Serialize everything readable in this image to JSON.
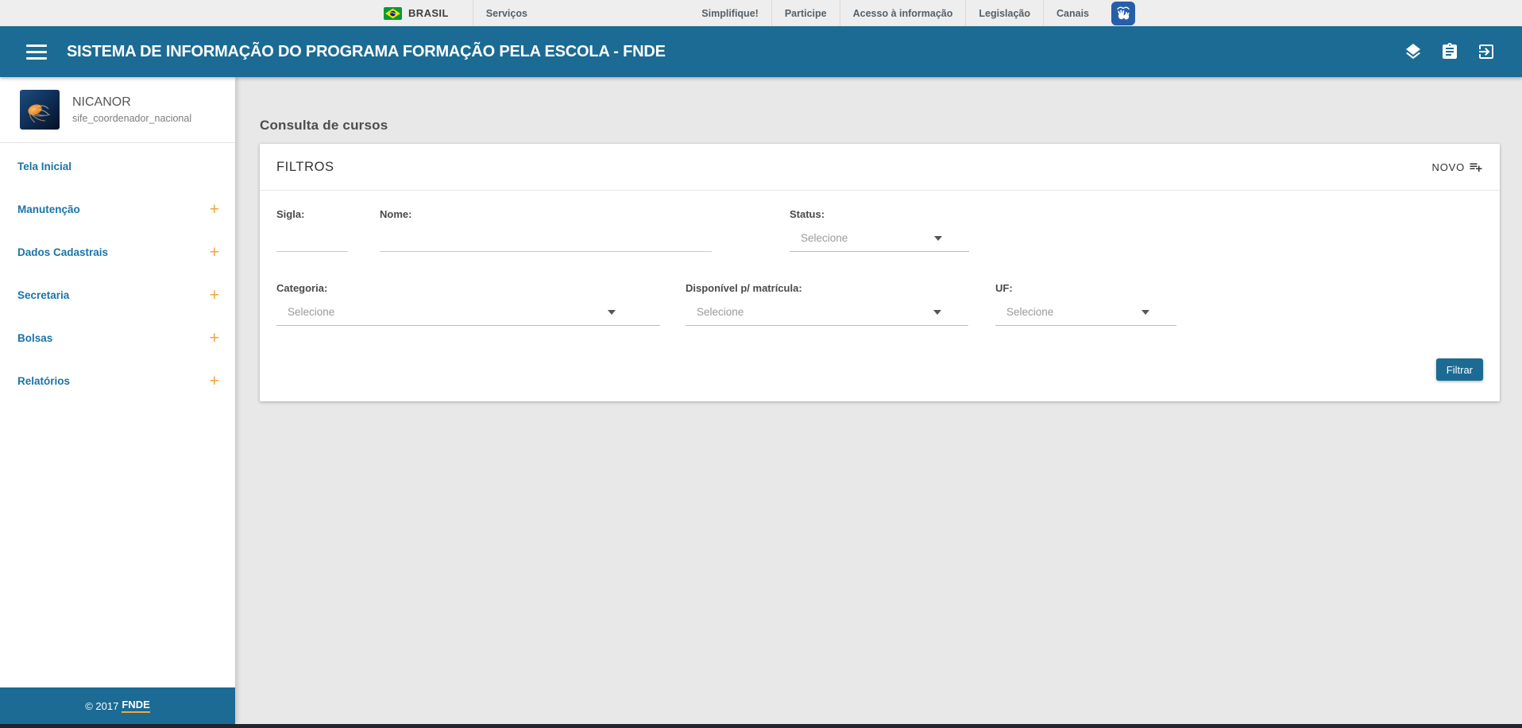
{
  "colors": {
    "primary_blue": "#1b6b94",
    "sidebar_link_blue": "#1b74a8",
    "accent_orange": "#f5a33c",
    "footer_underline_orange": "#f0a93a",
    "page_background": "#e8e8e8"
  },
  "gov_bar": {
    "brand": "BRASIL",
    "services_label": "Serviços",
    "links": [
      "Simplifique!",
      "Participe",
      "Acesso à informação",
      "Legislação",
      "Canais"
    ],
    "accessibility_icon": "vlibras-hands-icon"
  },
  "header": {
    "title": "SISTEMA DE INFORMAÇÃO DO PROGRAMA FORMAÇÃO PELA ESCOLA - FNDE",
    "icons": [
      "layers-icon",
      "clipboard-icon",
      "logout-icon"
    ]
  },
  "sidebar": {
    "user": {
      "name": "NICANOR",
      "role": "sife_coordenador_nacional"
    },
    "expand_glyph": "+",
    "items": [
      {
        "label": "Tela Inicial"
      },
      {
        "label": "Manutenção"
      },
      {
        "label": "Dados Cadastrais"
      },
      {
        "label": "Secretaria"
      },
      {
        "label": "Bolsas"
      },
      {
        "label": "Relatórios"
      }
    ],
    "footer": {
      "copyright": "© 2017",
      "brand": "FNDE"
    }
  },
  "main": {
    "page_title": "Consulta de cursos",
    "filters_card": {
      "title": "FILTROS",
      "new_button": "NOVO",
      "fields": {
        "sigla": {
          "label": "Sigla:",
          "value": ""
        },
        "nome": {
          "label": "Nome:",
          "value": ""
        },
        "status": {
          "label": "Status:",
          "placeholder": "Selecione"
        },
        "categoria": {
          "label": "Categoria:",
          "placeholder": "Selecione"
        },
        "disponivel": {
          "label": "Disponível p/ matrícula:",
          "placeholder": "Selecione"
        },
        "uf": {
          "label": "UF:",
          "placeholder": "Selecione"
        }
      },
      "submit_button": "Filtrar"
    }
  }
}
